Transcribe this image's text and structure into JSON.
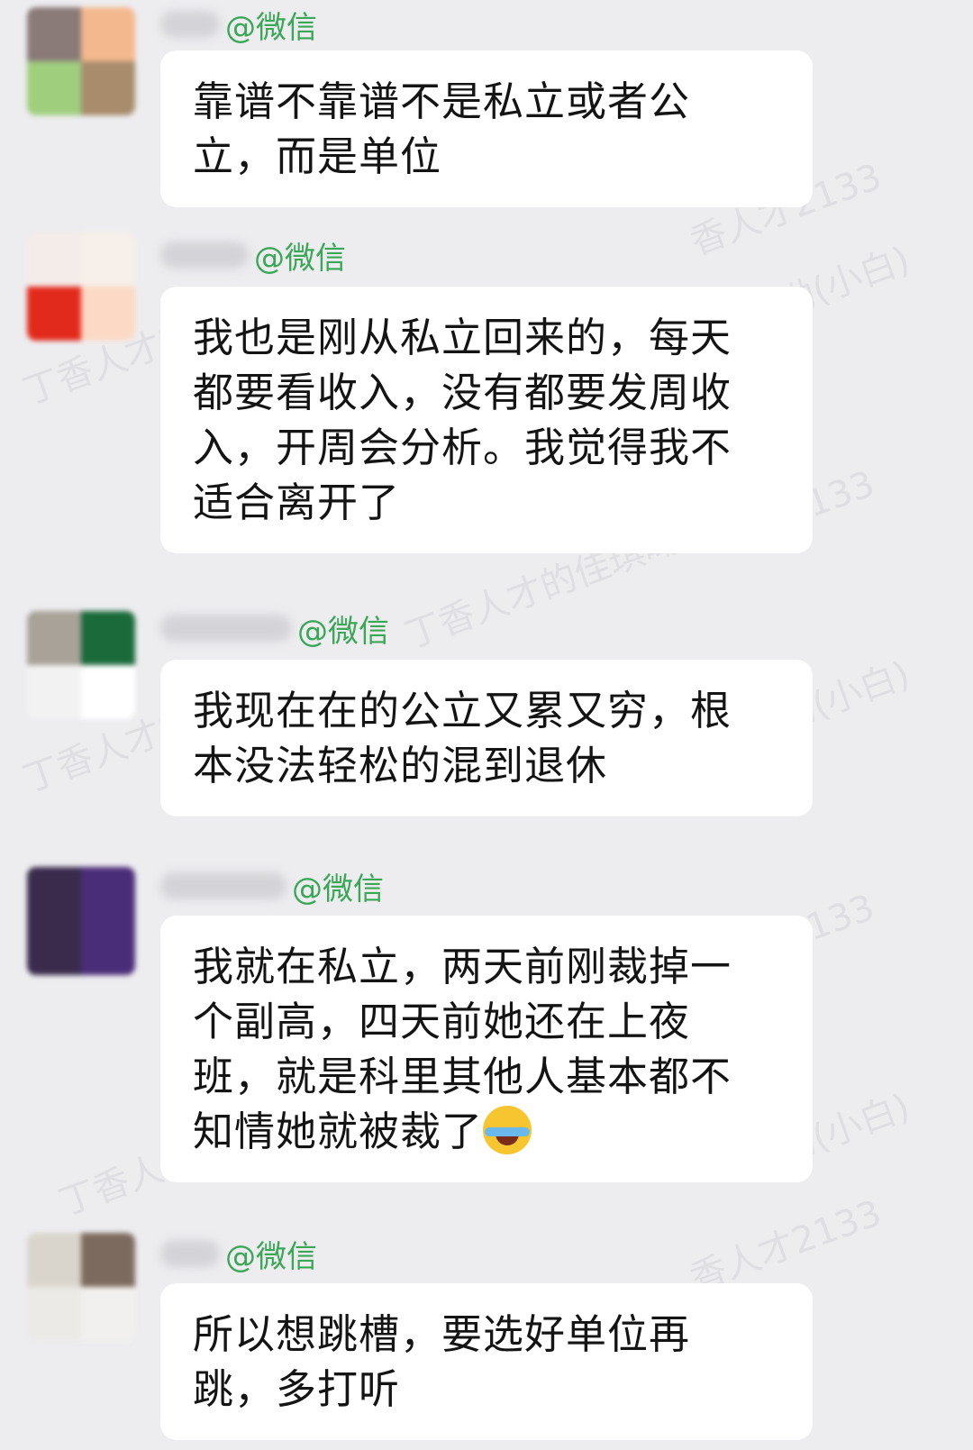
{
  "messages": [
    {
      "sender_tag": "@微信",
      "lines": [
        "靠谱不靠谱不是私立或者公",
        "立，而是单位"
      ]
    },
    {
      "sender_tag": "@微信",
      "lines": [
        "我也是刚从私立回来的，每天",
        "都要看收入，没有都要发周收",
        "入，开周会分析。我觉得我不",
        "适合离开了"
      ]
    },
    {
      "sender_tag": "@微信",
      "lines": [
        "我现在在的公立又累又穷，根",
        "本没法轻松的混到退休"
      ]
    },
    {
      "sender_tag": "@微信",
      "lines": [
        "我就在私立，两天前刚裁掉一",
        "个副高，四天前她还在上夜",
        "班，就是科里其他人基本都不",
        "知情她就被裁了"
      ],
      "emoji": "face-with-tears-of-joy-icon"
    },
    {
      "sender_tag": "@微信",
      "lines": [
        "所以想跳槽，要选好单位再",
        "跳，多打听"
      ]
    }
  ],
  "watermarks": [
    "丁香人才的佳琪呦",
    "香人才2133",
    "呦(小白)",
    "丁香人才的",
    "2133"
  ],
  "colors": {
    "background": "#ededf0",
    "bubble": "#ffffff",
    "tag": "#3aa757"
  }
}
